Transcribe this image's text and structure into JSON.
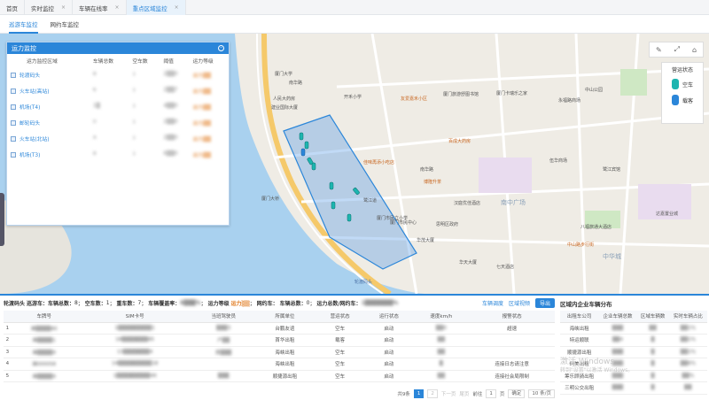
{
  "top_tabs": [
    {
      "label": "首页",
      "close": ""
    },
    {
      "label": "实时监控",
      "close": "×"
    },
    {
      "label": "车辆在线率",
      "close": "×"
    },
    {
      "label": "重点区域监控",
      "close": "×"
    }
  ],
  "sub_tabs": [
    "巡游车监控",
    "网约车监控"
  ],
  "panel": {
    "title": "运力监控",
    "columns": [
      "运力监控区域",
      "车辆总数",
      "空车数",
      "阈值",
      "运力等级"
    ],
    "rows": [
      {
        "name": "轮渡码头",
        "total": "8",
        "empty": "1",
        "threshold": "2▒▒0",
        "level": "运力▒▒"
      },
      {
        "name": "火车站(高站)",
        "total": "6",
        "empty": "1",
        "threshold": "2▒▒7",
        "level": "运力▒▒"
      },
      {
        "name": "机场(T4)",
        "total": "1▒",
        "empty": "1",
        "threshold": "4▒▒0",
        "level": "运力▒▒"
      },
      {
        "name": "邮轮码头",
        "total": "0",
        "empty": "1",
        "threshold": "2▒▒0",
        "level": "运力▒▒"
      },
      {
        "name": "火车站(北站)",
        "total": "4",
        "empty": "1",
        "threshold": "2▒▒0",
        "level": "运力▒▒"
      },
      {
        "name": "机场(T3)",
        "total": "8",
        "empty": "1",
        "threshold": "6▒▒0",
        "level": "运力▒▒"
      }
    ]
  },
  "status_panel": {
    "title": "营运状态",
    "empty": "空车",
    "loaded": "载客",
    "empty_color": "#1db5b0",
    "loaded_color": "#2b86d9"
  },
  "map_labels": [
    {
      "t": "厦门大学",
      "c": ""
    },
    {
      "t": "南华路",
      "c": ""
    },
    {
      "t": "开禾小学",
      "c": ""
    },
    {
      "t": "友爱嘉禾小区",
      "c": "orange"
    },
    {
      "t": "厦门旅游舒图书馆",
      "c": ""
    },
    {
      "t": "厦门卡瑞乐之家",
      "c": ""
    },
    {
      "t": "永福路商场",
      "c": ""
    },
    {
      "t": "中山公园",
      "c": ""
    },
    {
      "t": "人民大药房",
      "c": ""
    },
    {
      "t": "建业国际大厦",
      "c": ""
    },
    {
      "t": "百成大药房",
      "c": "orange"
    },
    {
      "t": "佳味再添小吃店",
      "c": "orange"
    },
    {
      "t": "博隆升茶",
      "c": "orange"
    },
    {
      "t": "南华路",
      "c": ""
    },
    {
      "t": "厦门市民中心",
      "c": ""
    },
    {
      "t": "汉庭优佳酒店",
      "c": ""
    },
    {
      "t": "南中广场",
      "c": "big"
    },
    {
      "t": "厦门市民立小学",
      "c": ""
    },
    {
      "t": "华茂大厦",
      "c": ""
    },
    {
      "t": "思明区政府",
      "c": ""
    },
    {
      "t": "华天大厦",
      "c": ""
    },
    {
      "t": "中山路步行街",
      "c": "orange"
    },
    {
      "t": "八福旅通大酒店",
      "c": ""
    },
    {
      "t": "中华城",
      "c": "big"
    },
    {
      "t": "厦门大桥",
      "c": ""
    },
    {
      "t": "鹭江道",
      "c": ""
    },
    {
      "t": "七天酒店",
      "c": ""
    },
    {
      "t": "轮渡码头",
      "c": "blue"
    },
    {
      "t": "伍华商场",
      "c": ""
    },
    {
      "t": "鹭江宾馆",
      "c": ""
    },
    {
      "t": "达嘉置业城",
      "c": ""
    }
  ],
  "summary": {
    "area": "轮渡码头",
    "cruise_label": "巡游车：",
    "total_label": "车辆总数：",
    "total": "8",
    "empty_label": "空车数：",
    "empty": "1",
    "loaded_label": "重车数：",
    "loaded": "7",
    "coverage_label": "车辆覆盖率：",
    "coverage": "8▒▒▒%",
    "level_label": "运力等级",
    "level": "运力▒▒",
    "online_label": "网约车：",
    "online_total_label": "车辆总数：",
    "online_total": "0",
    "ratio_label": "运力总数/网约车：",
    "ratio": "1▒▒▒▒▒▒▒%",
    "btn_dispatch": "车辆调度",
    "btn_video": "区域视频",
    "btn_export": "导出"
  },
  "grid": {
    "columns": [
      "",
      "车牌号",
      "SIM卡号",
      "当班驾驶员",
      "所属单位",
      "营运状态",
      "运行状态",
      "速度km/h",
      "报警状态"
    ],
    "rows": [
      [
        "1",
        "闽▒▒▒▒80",
        "1▒▒▒▒▒▒▒▒▒1",
        "▒▒▒3",
        "台鹏友谊",
        "空车",
        "启动",
        "▒▒0",
        "超速"
      ],
      [
        "2",
        "闽▒▒▒▒1",
        "18▒▒▒▒▒▒▒85",
        "户▒▒",
        "首华出租",
        "载客",
        "启动",
        "▒▒",
        "",
        ""
      ],
      [
        "3",
        "闽▒▒▒▒9",
        "13▒▒▒▒▒▒▒4",
        "庞▒▒▒",
        "海峡出租",
        "空车",
        "启动",
        "▒▒",
        "",
        ""
      ],
      [
        "4",
        "闽000058",
        "14▒▒▒▒▒▒▒▒▒18",
        "",
        "海峡出租",
        "空车",
        "启动",
        "▒",
        "连接日志请注意"
      ],
      [
        "5",
        "闽▒▒▒▒9",
        "1▒▒▒▒▒▒▒▒▒49",
        "▒▒▒",
        "顺捷源出租",
        "空车",
        "启动",
        "▒▒",
        "连接社会局限制"
      ]
    ]
  },
  "pager": {
    "total": "共9条",
    "cur": "1",
    "p2": "2",
    "next": "下一页",
    "last": "尾页",
    "goto_label": "前往",
    "goto_val": "1",
    "page": "页",
    "ok": "确定",
    "size": "10 条/页"
  },
  "right": {
    "title": "区域内企业车辆分布",
    "columns": [
      "出租车公司",
      "企业车辆总数",
      "区域车辆数",
      "实时车辆占比"
    ],
    "rows": [
      [
        "海峡出租",
        "▒▒▒",
        "▒▒",
        "▒▒1%"
      ],
      [
        "特运顺联",
        "▒▒4",
        "▒",
        "▒▒1%"
      ],
      [
        "顺捷源出租",
        "▒▒▒",
        "▒",
        "▒▒1%"
      ],
      [
        "珂美出租",
        "▒▒▒",
        "▒",
        "▒▒6%"
      ],
      [
        "筹乐顾骑出租",
        "▒▒▒",
        "▒",
        "▒▒%"
      ],
      [
        "三明公交出租",
        "▒▒▒",
        "▒",
        "▒▒"
      ]
    ]
  },
  "watermark": {
    "line1": "激活 Windows",
    "line2": "转到\"设置\"以激活 Windows。"
  }
}
